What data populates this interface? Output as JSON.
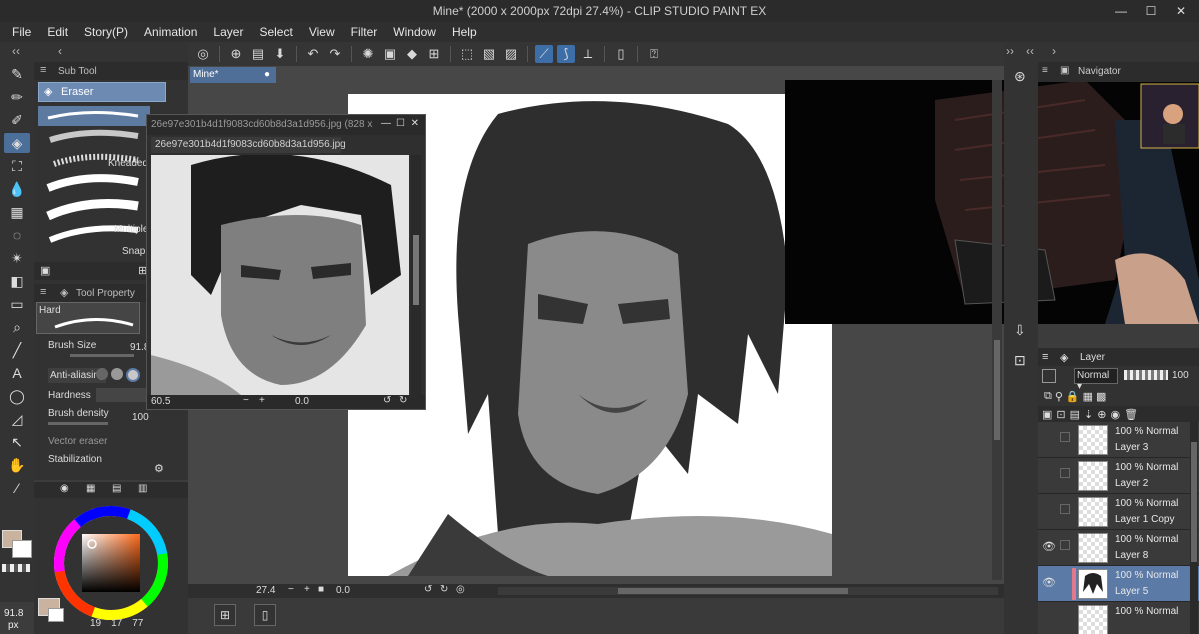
{
  "window": {
    "title": "Mine* (2000 x 2000px 72dpi 27.4%)  - CLIP STUDIO PAINT EX",
    "minimize": "—",
    "maximize": "☐",
    "close": "✕"
  },
  "menu": [
    "File",
    "Edit",
    "Story(P)",
    "Animation",
    "Layer",
    "Select",
    "View",
    "Filter",
    "Window",
    "Help"
  ],
  "subtool": {
    "header": "Sub Tool",
    "active": "Eraser",
    "brushes": [
      "",
      "",
      "Kneaded",
      "",
      "Multiple",
      "Snap"
    ]
  },
  "toolprop": {
    "header": "Tool Property",
    "preset": "Hard",
    "brush_size_label": "Brush Size",
    "brush_size_value": "91.8",
    "antialias_label": "Anti-aliasing",
    "hardness_label": "Hardness",
    "density_label": "Brush density",
    "density_value": "100",
    "vector_label": "Vector eraser",
    "stabilization_label": "Stabilization"
  },
  "color": {
    "main": "#c9b29e",
    "sub": "#ffffff",
    "size_readout": "91.8",
    "size_unit": "px",
    "nums": [
      "19",
      "17",
      "77"
    ]
  },
  "document": {
    "tab": "Mine*",
    "zoom": "27.4",
    "angle": "0.0"
  },
  "reference": {
    "title": "26e97e301b4d1f9083cd60b8d3a1d956.jpg (828 x",
    "tab": "26e97e301b4d1f9083cd60b8d3a1d956.jpg",
    "zoom": "60.5",
    "angle": "0.0"
  },
  "navigator": {
    "header": "Navigator"
  },
  "layers": {
    "header": "Layer",
    "blend_mode": "Normal",
    "opacity": "100",
    "rows": [
      {
        "mode": "100 % Normal",
        "name": "Layer 3",
        "eye": "",
        "selected": false
      },
      {
        "mode": "100 % Normal",
        "name": "Layer 2",
        "eye": "",
        "selected": false
      },
      {
        "mode": "100 % Normal",
        "name": "Layer 1 Copy",
        "eye": "",
        "selected": false
      },
      {
        "mode": "100 % Normal",
        "name": "Layer 8",
        "eye": "👁",
        "selected": false
      },
      {
        "mode": "100 % Normal",
        "name": "Layer 5",
        "eye": "👁",
        "selected": true
      },
      {
        "mode": "100 % Normal",
        "name": "",
        "eye": "",
        "selected": false
      }
    ]
  }
}
